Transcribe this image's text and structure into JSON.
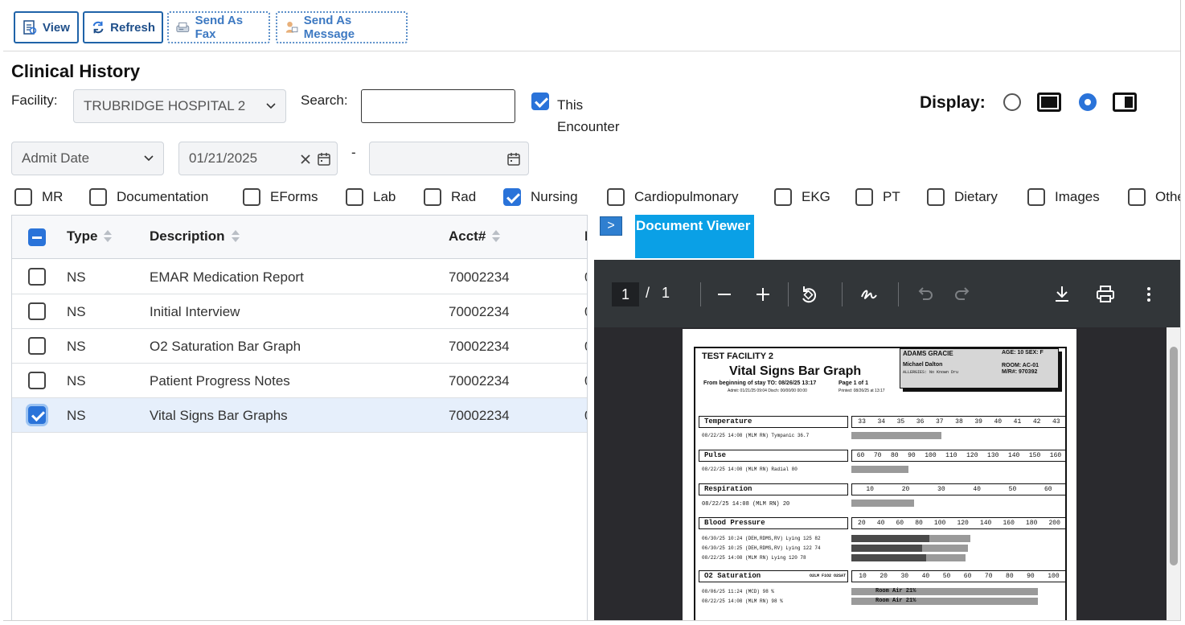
{
  "toolbar": {
    "view_label": "View",
    "refresh_label": "Refresh",
    "fax_label": "Send As Fax",
    "message_label": "Send As Message"
  },
  "page_title": "Clinical History",
  "filters": {
    "facility_label": "Facility:",
    "facility_value": "TRUBRIDGE HOSPITAL 2",
    "search_label": "Search:",
    "search_value": "",
    "this_encounter_label_line1": "This",
    "this_encounter_label_line2": "Encounter",
    "this_encounter_checked": true,
    "display_label": "Display:",
    "date_type_value": "Admit Date",
    "date_from": "01/21/2025",
    "date_sep": "-",
    "date_to": ""
  },
  "categories": [
    {
      "label": "MR",
      "checked": false
    },
    {
      "label": "Documentation",
      "checked": false
    },
    {
      "label": "EForms",
      "checked": false
    },
    {
      "label": "Lab",
      "checked": false
    },
    {
      "label": "Rad",
      "checked": false
    },
    {
      "label": "Nursing",
      "checked": true
    },
    {
      "label": "Cardiopulmonary",
      "checked": false
    },
    {
      "label": "EKG",
      "checked": false
    },
    {
      "label": "PT",
      "checked": false
    },
    {
      "label": "Dietary",
      "checked": false
    },
    {
      "label": "Images",
      "checked": false
    },
    {
      "label": "Othe",
      "checked": false
    }
  ],
  "table": {
    "headers": {
      "type": "Type",
      "description": "Description",
      "acct": "Acct#"
    },
    "rows": [
      {
        "type": "NS",
        "description": "EMAR Medication Report",
        "acct": "70002234",
        "trail": "0",
        "selected": false
      },
      {
        "type": "NS",
        "description": "Initial Interview",
        "acct": "70002234",
        "trail": "0",
        "selected": false
      },
      {
        "type": "NS",
        "description": "O2 Saturation Bar Graph",
        "acct": "70002234",
        "trail": "0",
        "selected": false
      },
      {
        "type": "NS",
        "description": "Patient Progress Notes",
        "acct": "70002234",
        "trail": "0",
        "selected": false
      },
      {
        "type": "NS",
        "description": "Vital Signs Bar Graphs",
        "acct": "70002234",
        "trail": "0",
        "selected": true
      }
    ]
  },
  "viewer": {
    "tab_label": "Document Viewer",
    "page_current": "1",
    "page_sep": "/",
    "page_total": "1"
  },
  "report": {
    "facility": "TEST FACILITY 2",
    "title": "Vital Signs Bar Graph",
    "range": "From beginning of stay  TO: 08/26/25 13:17",
    "page": "Page  1  of  1",
    "admit": "Admit: 01/21/25 09:04   Disch: 00/00/00 00:00",
    "printed": "Printed: 08/26/25 at 13:17",
    "patient_name": "ADAMS GRACIE",
    "age_sex": "AGE:  10  SEX:  F",
    "physician": "Michael Dalton",
    "room": "ROOM: AC-01",
    "mr": "M/R#:  970392",
    "allergies": "ALLERGIES: No Known Dru",
    "sections": {
      "temperature": {
        "label": "Temperature",
        "scale": [
          "33",
          "34",
          "35",
          "36",
          "37",
          "38",
          "39",
          "40",
          "41",
          "42",
          "43"
        ],
        "line": "08/22/25 14:08 (MLM RN)        Tympanic        36.7"
      },
      "pulse": {
        "label": "Pulse",
        "scale": [
          "60",
          "70",
          "80",
          "90",
          "100",
          "110",
          "120",
          "130",
          "140",
          "150",
          "160"
        ],
        "line": "08/22/25 14:08 (MLM RN)        Radial          80"
      },
      "respiration": {
        "label": "Respiration",
        "scale": [
          "10",
          "20",
          "30",
          "40",
          "50",
          "60"
        ],
        "line": "08/22/25 14:08 (MLM RN)        20"
      },
      "bp": {
        "label": "Blood Pressure",
        "scale": [
          "20",
          "40",
          "60",
          "80",
          "100",
          "120",
          "140",
          "160",
          "180",
          "200"
        ],
        "lines": [
          "06/30/25 10:24 (DEH,RDMS,RV) Lying    125  82",
          "06/30/25 10:25 (DEH,RDMS,RV) Lying    122  74",
          "08/22/25 14:08 (MLM RN)      Lying    120  78"
        ]
      },
      "o2": {
        "label": "O2 Saturation",
        "sub": "O2LM FiO2 O2SAT",
        "scale": [
          "10",
          "20",
          "30",
          "40",
          "50",
          "60",
          "70",
          "80",
          "90",
          "100"
        ],
        "lines": [
          "08/06/25 11:24 (MCD)                    98 %",
          "08/22/25 14:08 (MLM RN)                 98 %"
        ],
        "bar_label": "Room Air 21%"
      }
    }
  }
}
